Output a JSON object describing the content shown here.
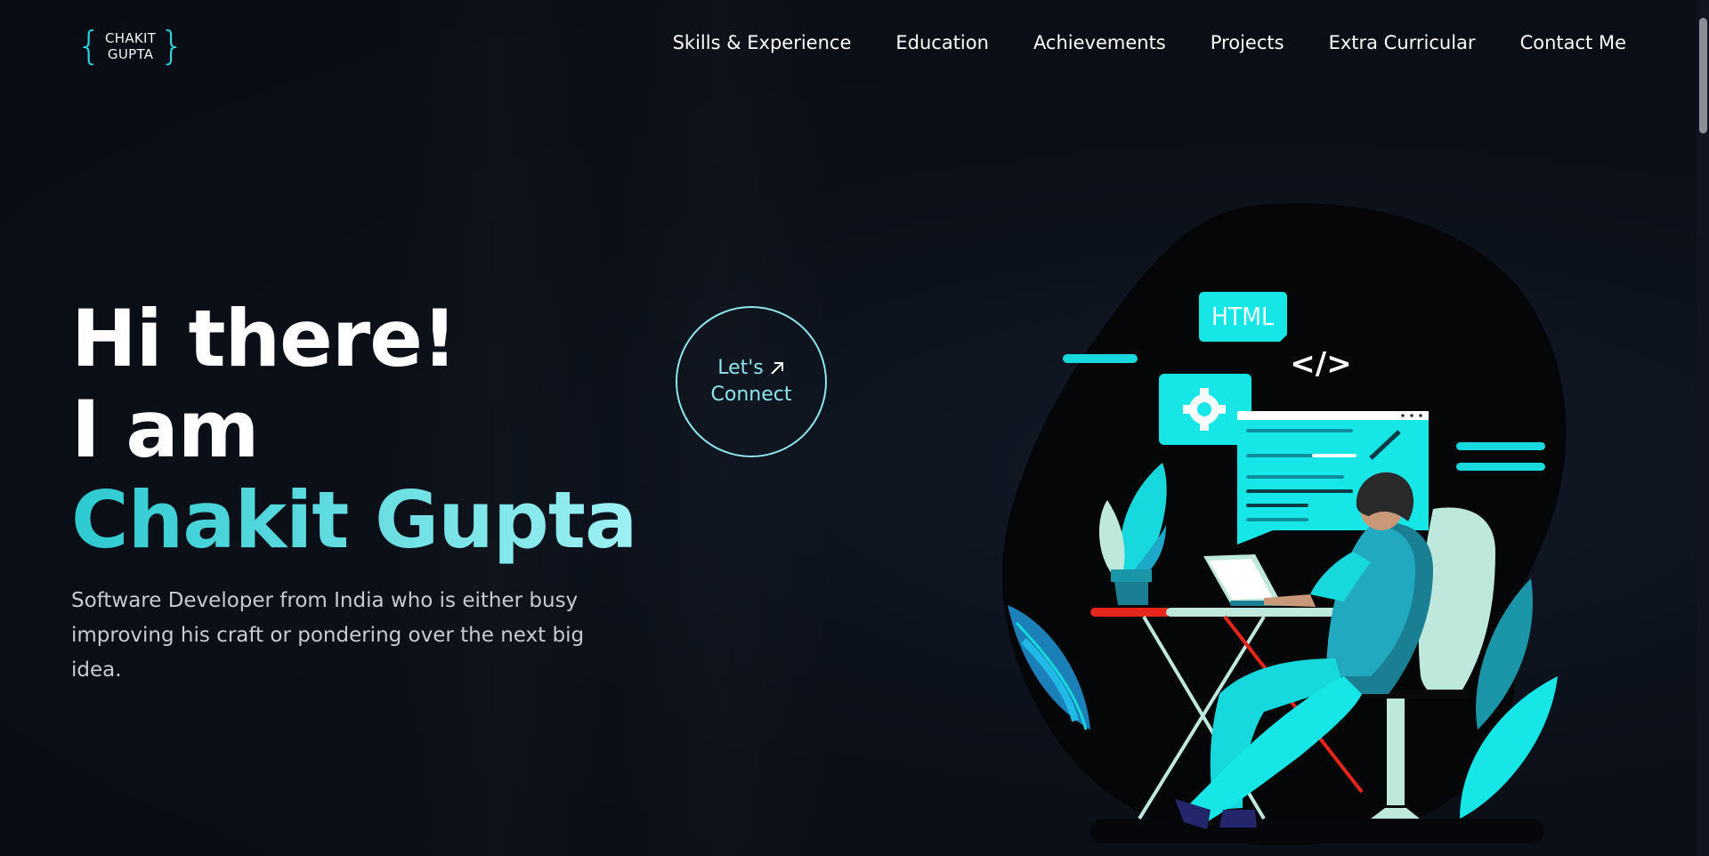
{
  "logo": {
    "line1": "CHAKIT",
    "line2": "GUPTA",
    "open_brace": "{",
    "close_brace": "}"
  },
  "nav": {
    "items": [
      {
        "label": "Skills & Experience"
      },
      {
        "label": "Education"
      },
      {
        "label": "Achievements"
      },
      {
        "label": "Projects"
      },
      {
        "label": "Extra Curricular"
      },
      {
        "label": "Contact Me"
      }
    ]
  },
  "hero": {
    "line1": "Hi there!",
    "line2": "I am",
    "name": "Chakit Gupta",
    "description": "Software Developer from India who is either busy improving his craft or pondering over the next big idea."
  },
  "connect": {
    "line1": "Let's",
    "line2": "Connect",
    "icon": "arrow-up-right-icon"
  },
  "illustration": {
    "badge_text": "HTML",
    "code_glyph": "</>"
  },
  "colors": {
    "accent": "#2ad4d9",
    "accent_light": "#9ef0f2",
    "background": "#0a0d16",
    "red": "#e5261a"
  }
}
